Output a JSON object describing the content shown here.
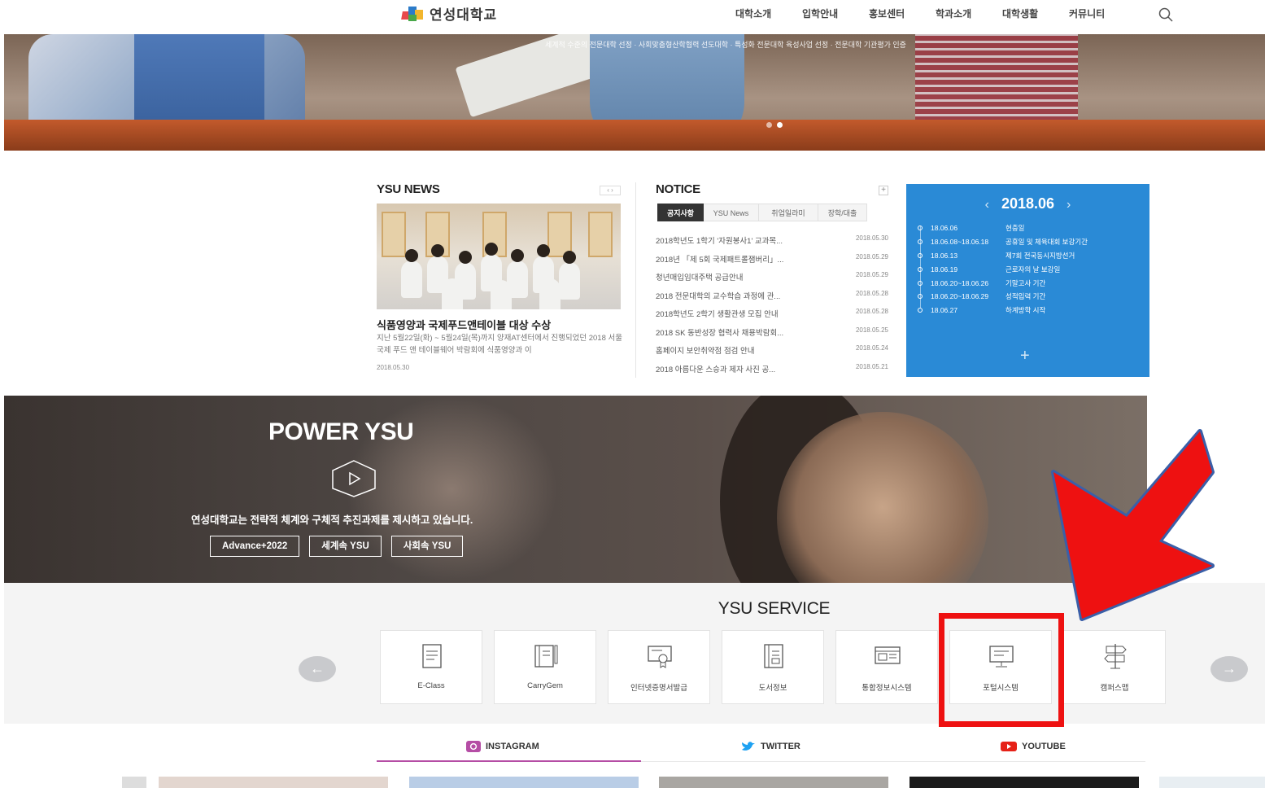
{
  "header": {
    "logo_text": "연성대학교",
    "nav": [
      "대학소개",
      "입학안내",
      "홍보센터",
      "학과소개",
      "대학생활",
      "커뮤니티"
    ],
    "search_icon": "search-icon"
  },
  "hero": {
    "caption": "세계적 수준의 전문대학 선정 · 사회맞춤형산학협력 선도대학 · 특성화 전문대학 육성사업 선정 · 전문대학 기관평가 인증"
  },
  "news": {
    "title": "YSU NEWS",
    "pager": "‹ ›",
    "headline": "식품영양과 국제푸드앤테이블 대상 수상",
    "summary": "지난 5월22일(화) ~ 5월24일(목)까지 양재AT센터에서 진행되었던 2018 서울 국제 푸드 앤 테이블웨어 박람회에 식품영양과 이",
    "date": "2018.05.30"
  },
  "notice": {
    "title": "NOTICE",
    "more": "+",
    "tabs": [
      "공지사항",
      "YSU News",
      "취업일라미",
      "장학/대출"
    ],
    "items": [
      {
        "title": "2018학년도 1학기 '자원봉사1' 교과목...",
        "date": "2018.05.30"
      },
      {
        "title": "2018년 「제 5회 국제패트롤잼버리」...",
        "date": "2018.05.29"
      },
      {
        "title": "청년매입임대주택 공급안내",
        "date": "2018.05.29"
      },
      {
        "title": "2018 전문대학의 교수학습 과정에 관...",
        "date": "2018.05.28"
      },
      {
        "title": "2018학년도 2학기 생활관생 모집 안내",
        "date": "2018.05.28"
      },
      {
        "title": "2018 SK 동반성장 협력사 채용박람회...",
        "date": "2018.05.25"
      },
      {
        "title": "홈페이지 보안취약점 점검 안내",
        "date": "2018.05.24"
      },
      {
        "title": "2018 아름다운 스승과 제자 사진 공...",
        "date": "2018.05.21"
      }
    ]
  },
  "calendar": {
    "month": "2018.06",
    "prev": "‹",
    "next": "›",
    "more": "+",
    "events": [
      {
        "date": "18.06.06",
        "name": "현충일"
      },
      {
        "date": "18.06.08~18.06.18",
        "name": "공휴일 및 체육대회 보강기간"
      },
      {
        "date": "18.06.13",
        "name": "제7회 전국동시지방선거"
      },
      {
        "date": "18.06.19",
        "name": "근로자의 날 보강일"
      },
      {
        "date": "18.06.20~18.06.26",
        "name": "기말고사 기간"
      },
      {
        "date": "18.06.20~18.06.29",
        "name": "성적입력 기간"
      },
      {
        "date": "18.06.27",
        "name": "하계방학 시작"
      }
    ]
  },
  "power": {
    "title": "POWER YSU",
    "text": "연성대학교는 전략적 체계와 구체적 추진과제를 제시하고 있습니다.",
    "buttons": [
      "Advance+2022",
      "세계속 YSU",
      "사회속 YSU"
    ]
  },
  "service": {
    "title": "YSU SERVICE",
    "prev": "←",
    "next": "→",
    "items": [
      {
        "label": "E-Class",
        "icon": "tablet-icon"
      },
      {
        "label": "CarryGem",
        "icon": "notebook-icon"
      },
      {
        "label": "인터넷증명서발급",
        "icon": "certificate-icon"
      },
      {
        "label": "도서정보",
        "icon": "book-icon"
      },
      {
        "label": "통합정보시스템",
        "icon": "browser-window-icon"
      },
      {
        "label": "포털시스템",
        "icon": "monitor-icon"
      },
      {
        "label": "캠퍼스맵",
        "icon": "signpost-icon"
      }
    ]
  },
  "social": {
    "tabs": [
      "INSTAGRAM",
      "TWITTER",
      "YOUTUBE"
    ],
    "colors": {
      "instagram": "#b54da5",
      "twitter": "#1da1f2",
      "youtube": "#e62117"
    }
  },
  "annotation": {
    "highlight_color": "#ee1111",
    "arrow_color": "#ee1111",
    "arrow_outline": "#3a5fa8"
  }
}
